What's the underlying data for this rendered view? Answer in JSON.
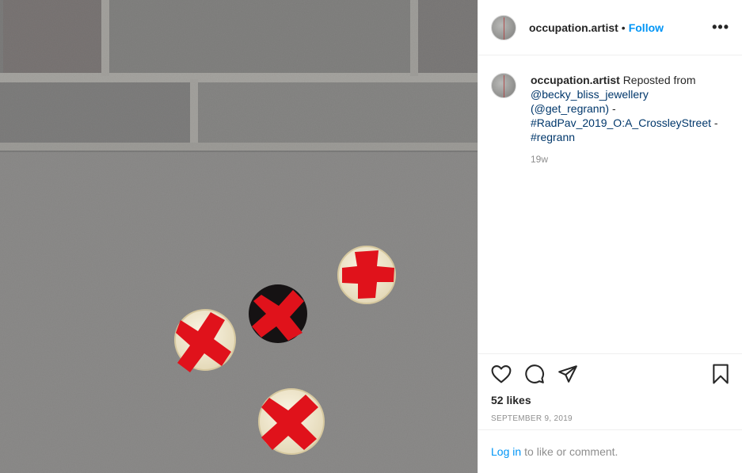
{
  "header": {
    "username": "occupation.artist",
    "separator": "•",
    "follow_label": "Follow",
    "more_label": "•••"
  },
  "caption": {
    "username": "occupation.artist",
    "text_before": "Reposted from",
    "mention_1": "@becky_bliss_jewellery",
    "mention_2": "(@get_regrann)",
    "dash_1": "-",
    "hashtag_1": "#RadPav_2019_O:A_CrossleyStreet",
    "dash_2": "-",
    "hashtag_2": "#regrann",
    "time_ago": "19w"
  },
  "actions": {
    "icons": [
      "heart-icon",
      "comment-icon",
      "share-icon",
      "bookmark-icon"
    ],
    "likes": "52 likes",
    "date": "September 9, 2019"
  },
  "footer": {
    "login_link": "Log in",
    "login_text": "to like or comment."
  },
  "colors": {
    "link_blue": "#0095f6",
    "mention_blue": "#00376b",
    "muted": "#8e8e8e",
    "badge_red": "#e0121b"
  }
}
